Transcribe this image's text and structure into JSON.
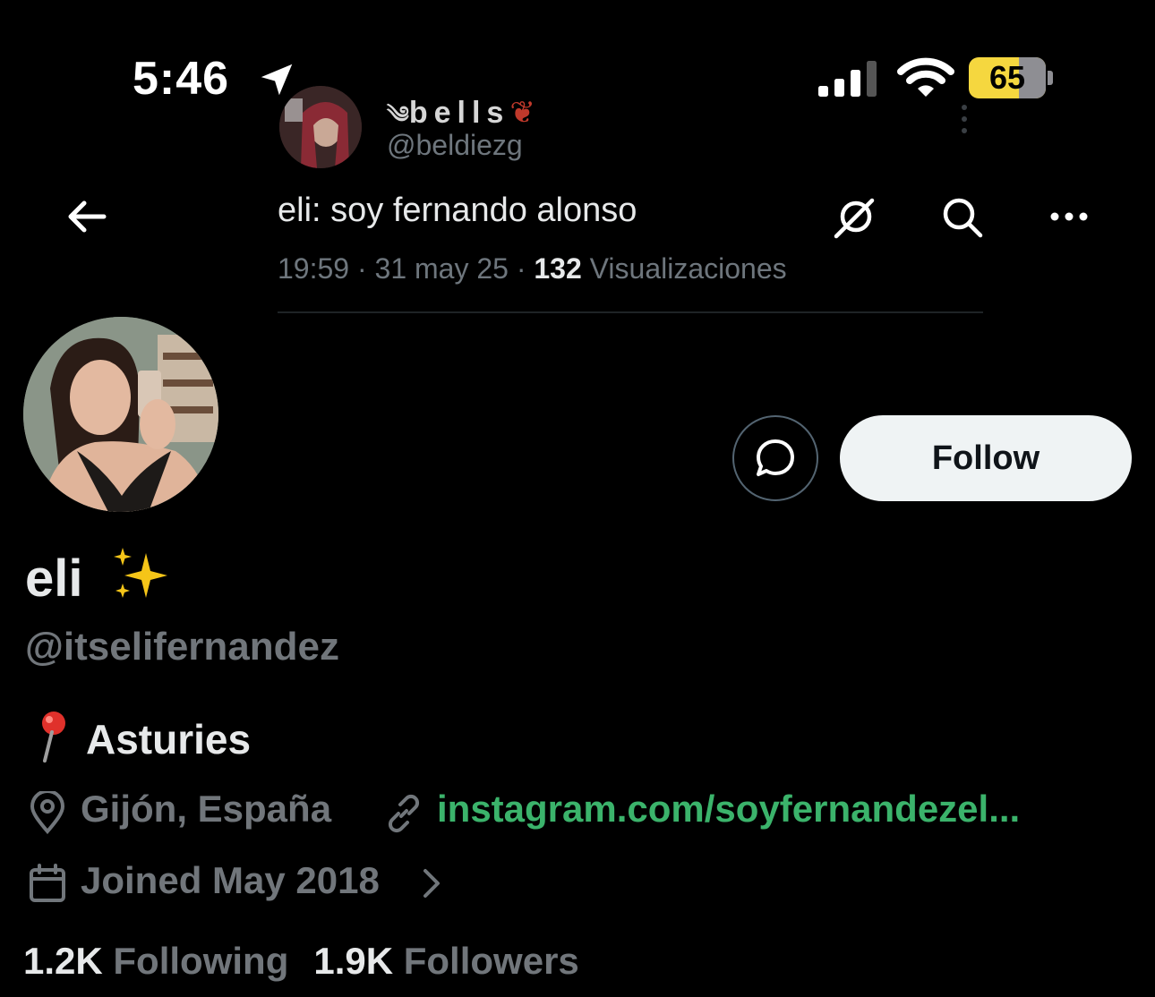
{
  "status_bar": {
    "time": "5:46",
    "battery": "65",
    "battery_level": 0.65
  },
  "quoted_tweet": {
    "name": "bells",
    "handle": "@beldiezg"
  },
  "tweet": {
    "text": "eli: soy fernando alonso",
    "time": "19:59",
    "date": "31 may 25",
    "views_count": "132",
    "views_label": "Visualizaciones"
  },
  "profile": {
    "follow_label": "Follow",
    "display_name": "eli",
    "sparkles": "✨",
    "handle": "@itselifernandez",
    "bio": "Asturies",
    "location": "Gijón, España",
    "link": "instagram.com/soyfernandezel...",
    "joined": "Joined May 2018",
    "following_count": "1.2K",
    "following_label": "Following",
    "followers_count": "1.9K",
    "followers_label": "Followers"
  },
  "colors": {
    "background": "#000000",
    "link": "#3bb36b",
    "muted": "#71767b",
    "battery": "#f5d73f"
  },
  "icons": [
    "location-arrow-icon",
    "signal-icon",
    "wifi-icon",
    "battery-icon",
    "back-arrow-icon",
    "grok-icon",
    "search-icon",
    "more-icon",
    "message-icon",
    "pin-emoji",
    "location-pin-icon",
    "link-icon",
    "calendar-icon",
    "chevron-right-icon"
  ]
}
